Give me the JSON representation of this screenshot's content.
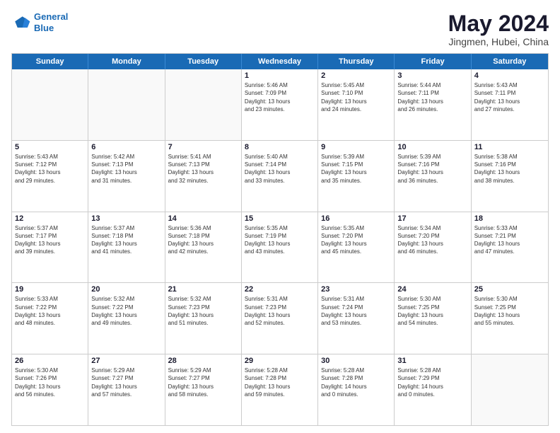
{
  "logo": {
    "line1": "General",
    "line2": "Blue"
  },
  "title": "May 2024",
  "subtitle": "Jingmen, Hubei, China",
  "days_of_week": [
    "Sunday",
    "Monday",
    "Tuesday",
    "Wednesday",
    "Thursday",
    "Friday",
    "Saturday"
  ],
  "weeks": [
    [
      {
        "day": "",
        "info": ""
      },
      {
        "day": "",
        "info": ""
      },
      {
        "day": "",
        "info": ""
      },
      {
        "day": "1",
        "info": "Sunrise: 5:46 AM\nSunset: 7:09 PM\nDaylight: 13 hours\nand 23 minutes."
      },
      {
        "day": "2",
        "info": "Sunrise: 5:45 AM\nSunset: 7:10 PM\nDaylight: 13 hours\nand 24 minutes."
      },
      {
        "day": "3",
        "info": "Sunrise: 5:44 AM\nSunset: 7:11 PM\nDaylight: 13 hours\nand 26 minutes."
      },
      {
        "day": "4",
        "info": "Sunrise: 5:43 AM\nSunset: 7:11 PM\nDaylight: 13 hours\nand 27 minutes."
      }
    ],
    [
      {
        "day": "5",
        "info": "Sunrise: 5:43 AM\nSunset: 7:12 PM\nDaylight: 13 hours\nand 29 minutes."
      },
      {
        "day": "6",
        "info": "Sunrise: 5:42 AM\nSunset: 7:13 PM\nDaylight: 13 hours\nand 31 minutes."
      },
      {
        "day": "7",
        "info": "Sunrise: 5:41 AM\nSunset: 7:13 PM\nDaylight: 13 hours\nand 32 minutes."
      },
      {
        "day": "8",
        "info": "Sunrise: 5:40 AM\nSunset: 7:14 PM\nDaylight: 13 hours\nand 33 minutes."
      },
      {
        "day": "9",
        "info": "Sunrise: 5:39 AM\nSunset: 7:15 PM\nDaylight: 13 hours\nand 35 minutes."
      },
      {
        "day": "10",
        "info": "Sunrise: 5:39 AM\nSunset: 7:16 PM\nDaylight: 13 hours\nand 36 minutes."
      },
      {
        "day": "11",
        "info": "Sunrise: 5:38 AM\nSunset: 7:16 PM\nDaylight: 13 hours\nand 38 minutes."
      }
    ],
    [
      {
        "day": "12",
        "info": "Sunrise: 5:37 AM\nSunset: 7:17 PM\nDaylight: 13 hours\nand 39 minutes."
      },
      {
        "day": "13",
        "info": "Sunrise: 5:37 AM\nSunset: 7:18 PM\nDaylight: 13 hours\nand 41 minutes."
      },
      {
        "day": "14",
        "info": "Sunrise: 5:36 AM\nSunset: 7:18 PM\nDaylight: 13 hours\nand 42 minutes."
      },
      {
        "day": "15",
        "info": "Sunrise: 5:35 AM\nSunset: 7:19 PM\nDaylight: 13 hours\nand 43 minutes."
      },
      {
        "day": "16",
        "info": "Sunrise: 5:35 AM\nSunset: 7:20 PM\nDaylight: 13 hours\nand 45 minutes."
      },
      {
        "day": "17",
        "info": "Sunrise: 5:34 AM\nSunset: 7:20 PM\nDaylight: 13 hours\nand 46 minutes."
      },
      {
        "day": "18",
        "info": "Sunrise: 5:33 AM\nSunset: 7:21 PM\nDaylight: 13 hours\nand 47 minutes."
      }
    ],
    [
      {
        "day": "19",
        "info": "Sunrise: 5:33 AM\nSunset: 7:22 PM\nDaylight: 13 hours\nand 48 minutes."
      },
      {
        "day": "20",
        "info": "Sunrise: 5:32 AM\nSunset: 7:22 PM\nDaylight: 13 hours\nand 49 minutes."
      },
      {
        "day": "21",
        "info": "Sunrise: 5:32 AM\nSunset: 7:23 PM\nDaylight: 13 hours\nand 51 minutes."
      },
      {
        "day": "22",
        "info": "Sunrise: 5:31 AM\nSunset: 7:23 PM\nDaylight: 13 hours\nand 52 minutes."
      },
      {
        "day": "23",
        "info": "Sunrise: 5:31 AM\nSunset: 7:24 PM\nDaylight: 13 hours\nand 53 minutes."
      },
      {
        "day": "24",
        "info": "Sunrise: 5:30 AM\nSunset: 7:25 PM\nDaylight: 13 hours\nand 54 minutes."
      },
      {
        "day": "25",
        "info": "Sunrise: 5:30 AM\nSunset: 7:25 PM\nDaylight: 13 hours\nand 55 minutes."
      }
    ],
    [
      {
        "day": "26",
        "info": "Sunrise: 5:30 AM\nSunset: 7:26 PM\nDaylight: 13 hours\nand 56 minutes."
      },
      {
        "day": "27",
        "info": "Sunrise: 5:29 AM\nSunset: 7:27 PM\nDaylight: 13 hours\nand 57 minutes."
      },
      {
        "day": "28",
        "info": "Sunrise: 5:29 AM\nSunset: 7:27 PM\nDaylight: 13 hours\nand 58 minutes."
      },
      {
        "day": "29",
        "info": "Sunrise: 5:28 AM\nSunset: 7:28 PM\nDaylight: 13 hours\nand 59 minutes."
      },
      {
        "day": "30",
        "info": "Sunrise: 5:28 AM\nSunset: 7:28 PM\nDaylight: 14 hours\nand 0 minutes."
      },
      {
        "day": "31",
        "info": "Sunrise: 5:28 AM\nSunset: 7:29 PM\nDaylight: 14 hours\nand 0 minutes."
      },
      {
        "day": "",
        "info": ""
      }
    ]
  ]
}
